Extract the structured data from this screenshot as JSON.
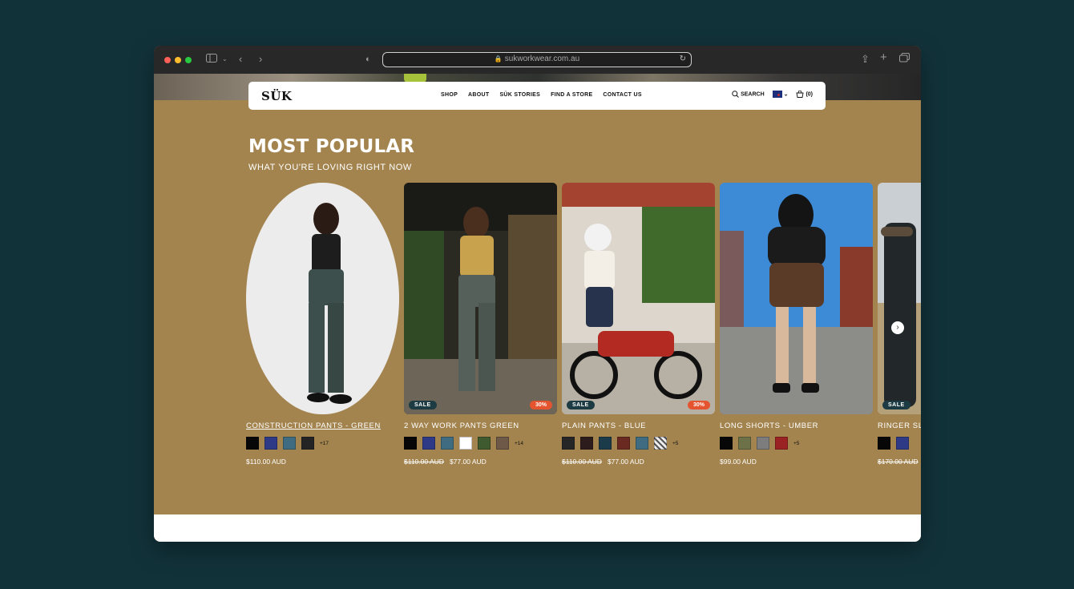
{
  "browser": {
    "url": "sukworkwear.com.au"
  },
  "site": {
    "logo": "SÜK",
    "nav": [
      "SHOP",
      "ABOUT",
      "SÜK STORIES",
      "FIND A STORE",
      "CONTACT US"
    ],
    "search_label": "SEARCH",
    "cart_label": "(0)"
  },
  "section": {
    "title": "MOST POPULAR",
    "subtitle": "WHAT YOU'RE LOVING RIGHT NOW"
  },
  "products": [
    {
      "title": "CONSTRUCTION PANTS - GREEN",
      "swatches": [
        "#070707",
        "#2e3a86",
        "#3f6c80",
        "#242424"
      ],
      "more": "+17",
      "price": "$110.00 AUD",
      "old_price": "",
      "sale": "",
      "discount": ""
    },
    {
      "title": "2 WAY WORK PANTS GREEN",
      "swatches": [
        "#070707",
        "#2e3a86",
        "#3f6c80",
        "#ffffff",
        "#3f5a2e",
        "#6e5848"
      ],
      "more": "+14",
      "price": "$77.00 AUD",
      "old_price": "$110.00 AUD",
      "sale": "SALE",
      "discount": "30%"
    },
    {
      "title": "PLAIN PANTS - BLUE",
      "swatches": [
        "#262626",
        "#2c1c1c",
        "#1b3a4a",
        "#6a2a22",
        "#3f6c80",
        "#8a8a8a"
      ],
      "more": "+5",
      "price": "$77.00 AUD",
      "old_price": "$110.00 AUD",
      "sale": "SALE",
      "discount": "30%"
    },
    {
      "title": "LONG SHORTS - UMBER",
      "swatches": [
        "#070707",
        "#6d7148",
        "#7d7d7d",
        "#9b2222"
      ],
      "more": "+5",
      "price": "$99.00 AUD",
      "old_price": "",
      "sale": "",
      "discount": ""
    },
    {
      "title": "RINGER SL",
      "swatches": [
        "#070707",
        "#2e3a86"
      ],
      "more": "",
      "price": "",
      "old_price": "$170.00 AUD",
      "sale": "SALE",
      "discount": ""
    }
  ]
}
